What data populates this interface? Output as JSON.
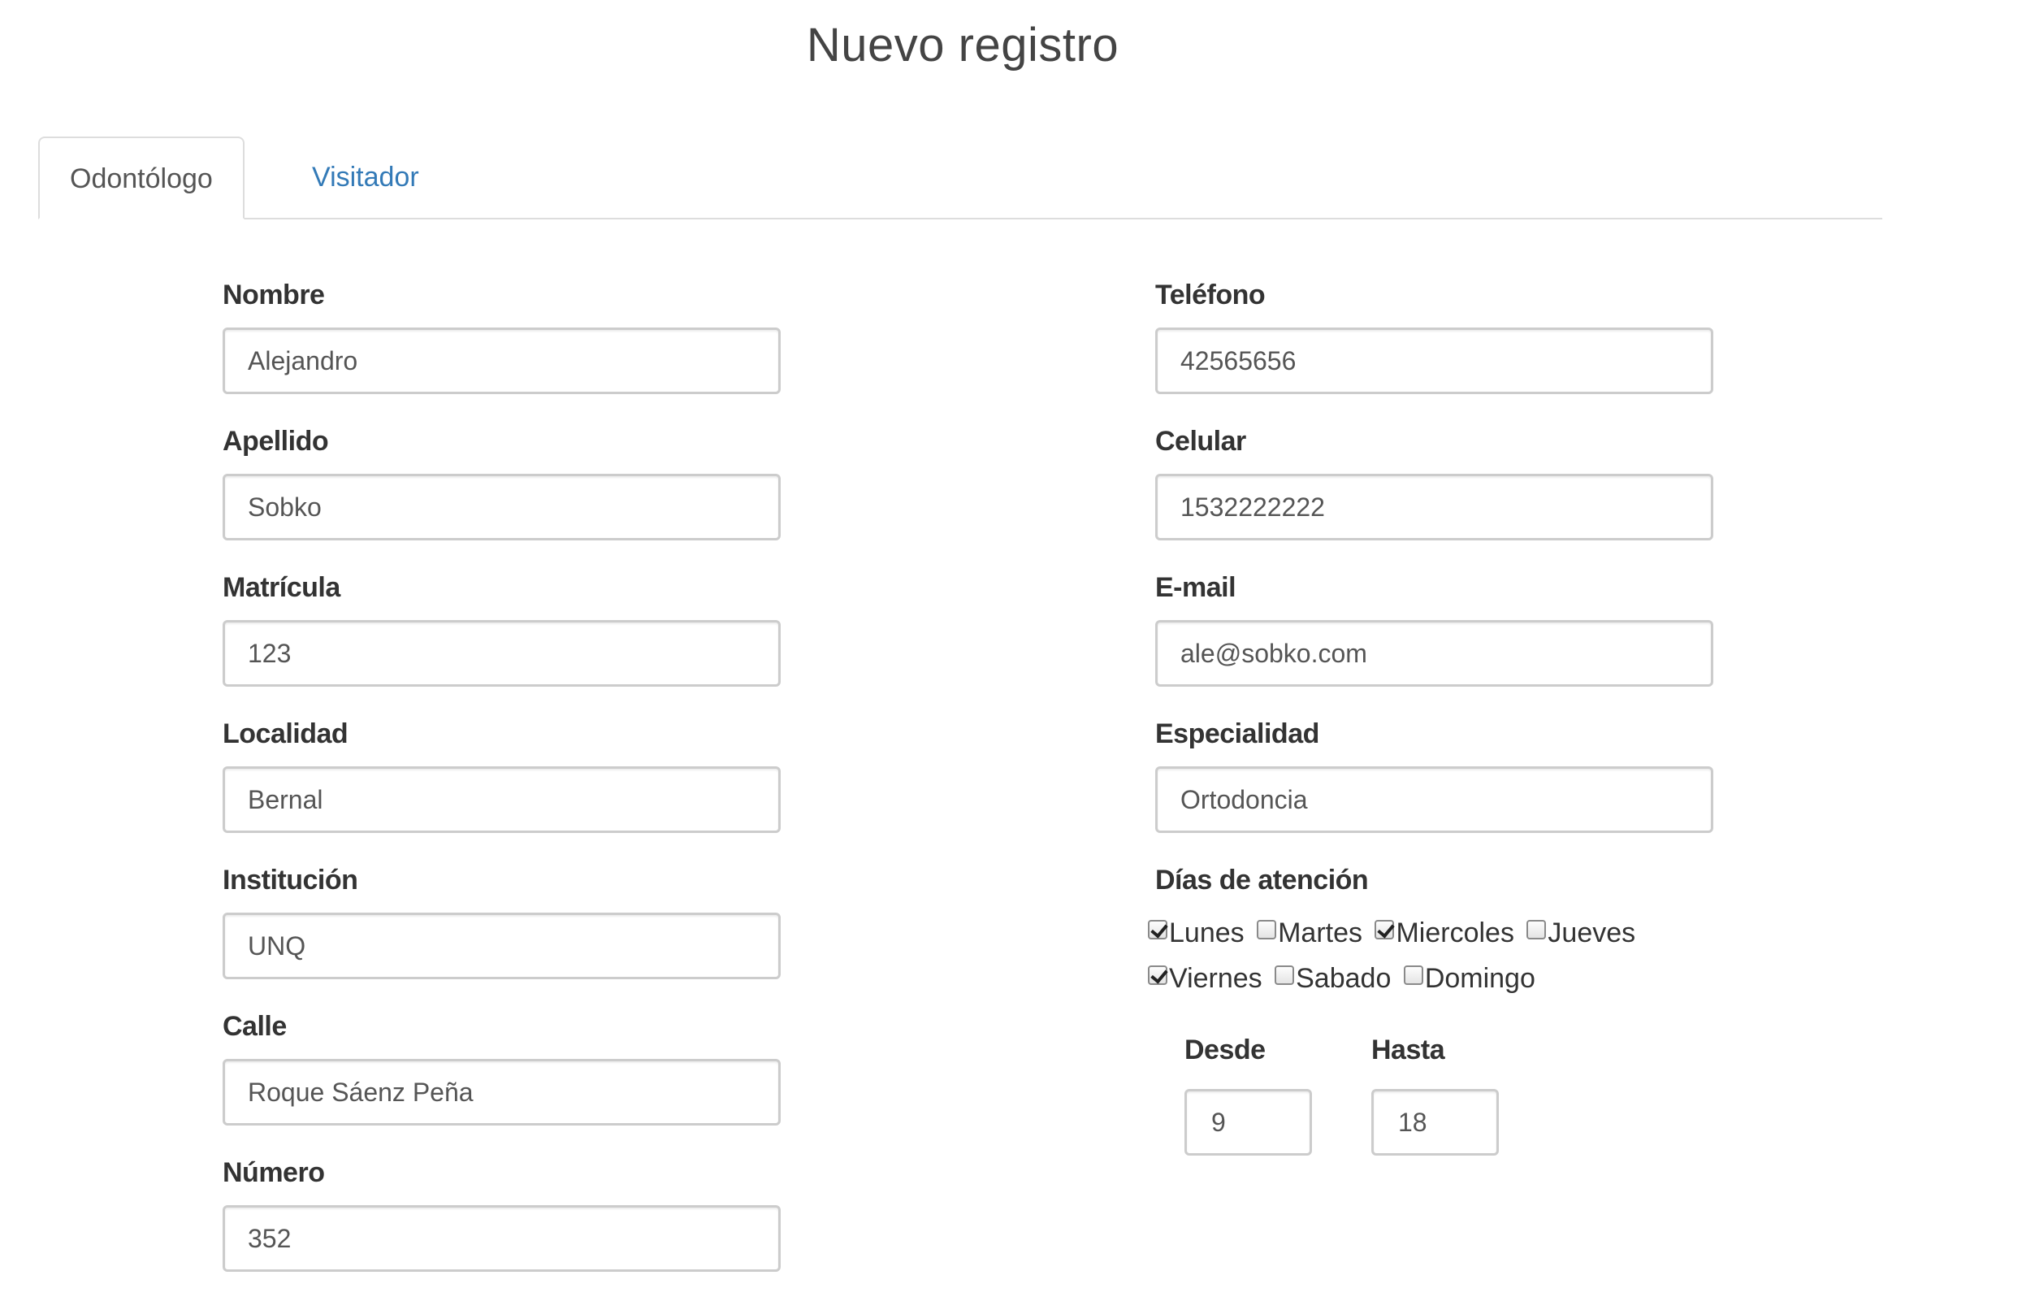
{
  "page": {
    "title": "Nuevo registro"
  },
  "tabs": [
    {
      "label": "Odontólogo",
      "active": true
    },
    {
      "label": "Visitador",
      "active": false
    }
  ],
  "form": {
    "left": {
      "nombre": {
        "label": "Nombre",
        "value": "Alejandro"
      },
      "apellido": {
        "label": "Apellido",
        "value": "Sobko"
      },
      "matricula": {
        "label": "Matrícula",
        "value": "123"
      },
      "localidad": {
        "label": "Localidad",
        "value": "Bernal"
      },
      "institucion": {
        "label": "Institución",
        "value": "UNQ"
      },
      "calle": {
        "label": "Calle",
        "value": "Roque Sáenz Peña"
      },
      "numero": {
        "label": "Número",
        "value": "352"
      }
    },
    "right": {
      "telefono": {
        "label": "Teléfono",
        "value": "42565656"
      },
      "celular": {
        "label": "Celular",
        "value": "1532222222"
      },
      "email": {
        "label": "E-mail",
        "value": "ale@sobko.com"
      },
      "especialidad": {
        "label": "Especialidad",
        "value": "Ortodoncia"
      },
      "dias": {
        "label": "Días de atención",
        "items": [
          {
            "label": "Lunes",
            "checked": true
          },
          {
            "label": "Martes",
            "checked": false
          },
          {
            "label": "Miercoles",
            "checked": true
          },
          {
            "label": "Jueves",
            "checked": false
          },
          {
            "label": "Viernes",
            "checked": true
          },
          {
            "label": "Sabado",
            "checked": false
          },
          {
            "label": "Domingo",
            "checked": false
          }
        ]
      },
      "desde": {
        "label": "Desde",
        "value": "9"
      },
      "hasta": {
        "label": "Hasta",
        "value": "18"
      }
    }
  },
  "colors": {
    "link": "#337ab7",
    "border": "#cccccc",
    "tab_border": "#dddddd"
  }
}
